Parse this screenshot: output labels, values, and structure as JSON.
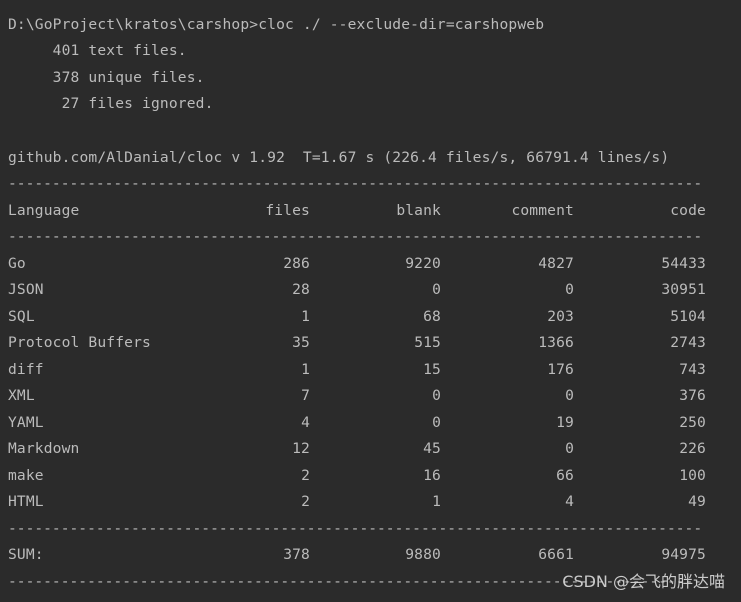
{
  "command_line": "D:\\GoProject\\kratos\\carshop>cloc ./ --exclude-dir=carshopweb",
  "summary": {
    "text_files": "     401 text files.",
    "unique_files": "     378 unique files.",
    "ignored_files": "      27 files ignored."
  },
  "version_line": "github.com/AlDanial/cloc v 1.92  T=1.67 s (226.4 files/s, 66791.4 lines/s)",
  "separator": "-------------------------------------------------------------------------------",
  "table": {
    "headers": {
      "language": "Language",
      "files": "files",
      "blank": "blank",
      "comment": "comment",
      "code": "code"
    },
    "rows": [
      {
        "language": "Go",
        "files": "286",
        "blank": "9220",
        "comment": "4827",
        "code": "54433"
      },
      {
        "language": "JSON",
        "files": "28",
        "blank": "0",
        "comment": "0",
        "code": "30951"
      },
      {
        "language": "SQL",
        "files": "1",
        "blank": "68",
        "comment": "203",
        "code": "5104"
      },
      {
        "language": "Protocol Buffers",
        "files": "35",
        "blank": "515",
        "comment": "1366",
        "code": "2743"
      },
      {
        "language": "diff",
        "files": "1",
        "blank": "15",
        "comment": "176",
        "code": "743"
      },
      {
        "language": "XML",
        "files": "7",
        "blank": "0",
        "comment": "0",
        "code": "376"
      },
      {
        "language": "YAML",
        "files": "4",
        "blank": "0",
        "comment": "19",
        "code": "250"
      },
      {
        "language": "Markdown",
        "files": "12",
        "blank": "45",
        "comment": "0",
        "code": "226"
      },
      {
        "language": "make",
        "files": "2",
        "blank": "16",
        "comment": "66",
        "code": "100"
      },
      {
        "language": "HTML",
        "files": "2",
        "blank": "1",
        "comment": "4",
        "code": "49"
      }
    ],
    "sum": {
      "language": "SUM:",
      "files": "378",
      "blank": "9880",
      "comment": "6661",
      "code": "94975"
    }
  },
  "watermark": "CSDN @会飞的胖达喵",
  "colors": {
    "background": "#2b2b2b",
    "text": "#bbbbbb"
  }
}
